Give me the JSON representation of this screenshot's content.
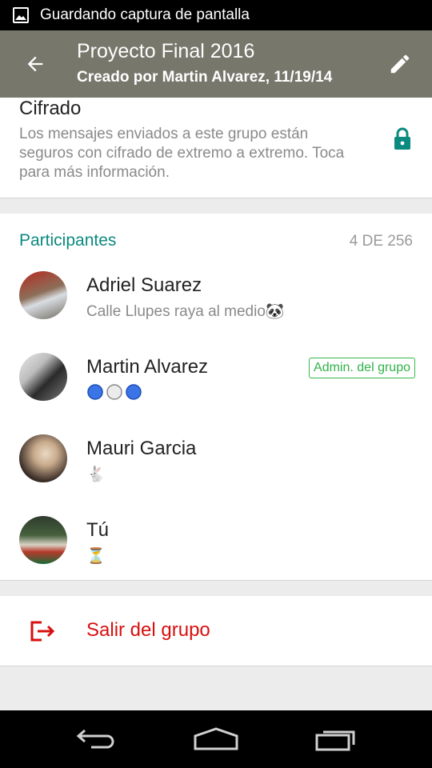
{
  "status_bar": {
    "text": "Guardando captura de pantalla",
    "icon": "image-icon"
  },
  "app_bar": {
    "title": "Proyecto Final 2016",
    "subtitle": "Creado por Martin Alvarez, 11/19/14",
    "back_icon": "arrow-back-icon",
    "edit_icon": "pencil-icon",
    "color": "#77776c"
  },
  "encryption": {
    "title": "Cifrado",
    "description": "Los mensajes enviados a este grupo están seguros con cifrado de extremo a extremo. Toca para más información.",
    "icon": "lock-icon",
    "icon_color": "#0b8a80"
  },
  "participants": {
    "header": "Participantes",
    "count": "4 DE 256",
    "items": [
      {
        "name": "Adriel Suarez",
        "status": "Calle Llupes raya al medio🐼",
        "badge": ""
      },
      {
        "name": "Martin Alvarez",
        "status": "",
        "status_icons": [
          "blue-circle",
          "white-circle",
          "blue-circle"
        ],
        "badge": "Admin. del grupo"
      },
      {
        "name": "Mauri Garcia",
        "status": "🐇",
        "badge": ""
      },
      {
        "name": "Tú",
        "status": "⏳",
        "badge": ""
      }
    ]
  },
  "leave": {
    "label": "Salir del grupo",
    "icon": "exit-icon",
    "color": "#d80f0f"
  },
  "nav_bar": {
    "icons": [
      "back-nav-icon",
      "home-nav-icon",
      "recents-nav-icon"
    ]
  }
}
